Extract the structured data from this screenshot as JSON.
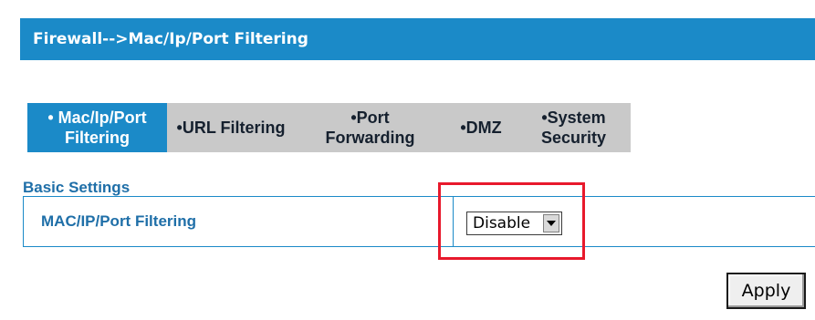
{
  "header": {
    "title": "Firewall-->Mac/Ip/Port Filtering"
  },
  "tabs": [
    {
      "lines": [
        "• Mac/Ip/Port",
        "Filtering"
      ],
      "active": true
    },
    {
      "lines": [
        "•URL Filtering"
      ],
      "active": false
    },
    {
      "lines": [
        "•Port",
        "Forwarding"
      ],
      "active": false
    },
    {
      "lines": [
        "•DMZ"
      ],
      "active": false
    },
    {
      "lines": [
        "•System",
        "Security"
      ],
      "active": false
    }
  ],
  "basic_settings": {
    "section_title": "Basic Settings",
    "filtering_label": "MAC/IP/Port Filtering",
    "filtering_value": "Disable"
  },
  "actions": {
    "apply_label": "Apply"
  },
  "colors": {
    "accent": "#1b8ac8",
    "tab_inactive": "#c9c9c9",
    "highlight": "#e8192c",
    "label_text": "#1f6fa8"
  }
}
